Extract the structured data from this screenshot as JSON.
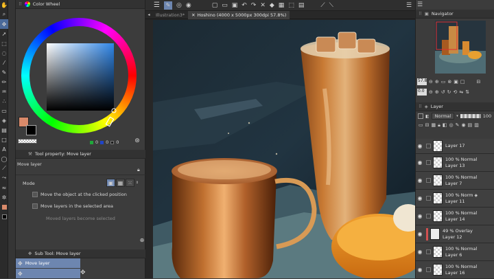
{
  "color_wheel": {
    "title": "Color Wheel",
    "rgb": [
      "0",
      "0",
      "0"
    ],
    "hsv_indicator": "0",
    "main_color": "#d98a6a",
    "sub_color": "#000000"
  },
  "tool_property": {
    "title": "Tool property: Move layer",
    "tool_name": "Move layer",
    "mode_label": "Mode",
    "options": [
      {
        "label": "Move the object at the clicked position",
        "checked": false,
        "enabled": true
      },
      {
        "label": "Move layers in the selected area",
        "checked": false,
        "enabled": true
      },
      {
        "label": "Moved layers become selected",
        "checked": false,
        "enabled": false
      }
    ]
  },
  "sub_tool": {
    "title": "Sub Tool: Move layer",
    "items": [
      "Move layer"
    ]
  },
  "tabs": [
    {
      "label": "Illustration3*",
      "active": false
    },
    {
      "label": "Hoshino (4000 x 5000px 300dpi 57.8%)",
      "active": true
    }
  ],
  "navigator": {
    "title": "Navigator",
    "zoom": "57.8",
    "angle": "0.0"
  },
  "layer_panel": {
    "title": "Layer",
    "blend_mode": "Normal",
    "opacity": "100",
    "layers": [
      {
        "opacity": "",
        "blend": "",
        "name": "Layer 17"
      },
      {
        "opacity": "100 %",
        "blend": "Normal",
        "name": "Layer 13"
      },
      {
        "opacity": "100 %",
        "blend": "Normal",
        "name": "Layer 7"
      },
      {
        "opacity": "100 %",
        "blend": "Norm",
        "name": "Layer 11"
      },
      {
        "opacity": "100 %",
        "blend": "Normal",
        "name": "Layer 14"
      },
      {
        "opacity": "49 %",
        "blend": "Overlay",
        "name": "Layer 12"
      },
      {
        "opacity": "100 %",
        "blend": "Normal",
        "name": "Layer 6"
      },
      {
        "opacity": "100 %",
        "blend": "Normal",
        "name": "Layer 16"
      }
    ]
  },
  "colors": {
    "accent": "#4a6a9a",
    "selection": "#6d86b0",
    "panel": "#3c3c3c"
  }
}
